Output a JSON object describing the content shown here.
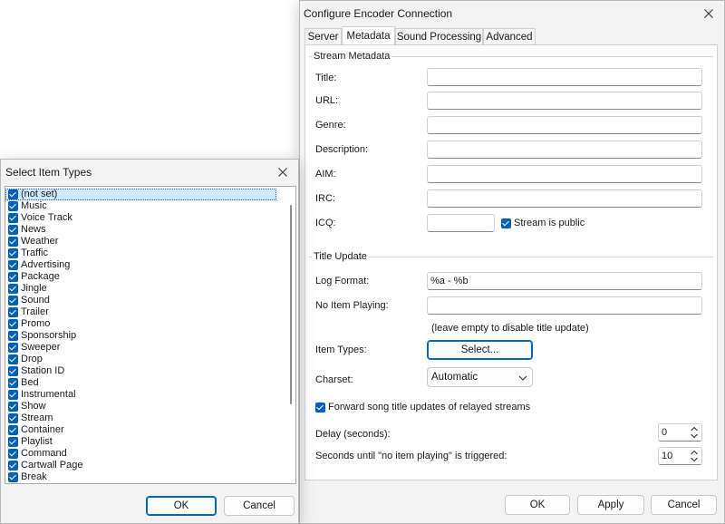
{
  "encoder_dialog": {
    "title": "Configure Encoder Connection",
    "tabs": [
      "Server",
      "Metadata",
      "Sound Processing",
      "Advanced"
    ],
    "active_tab": "Metadata",
    "stream_metadata": {
      "group_label": "Stream Metadata",
      "title_label": "Title:",
      "title_value": "",
      "url_label": "URL:",
      "url_value": "",
      "genre_label": "Genre:",
      "genre_value": "",
      "description_label": "Description:",
      "description_value": "",
      "aim_label": "AIM:",
      "aim_value": "",
      "irc_label": "IRC:",
      "irc_value": "",
      "icq_label": "ICQ:",
      "icq_value": "",
      "stream_public_label": "Stream is public",
      "stream_public_checked": true
    },
    "title_update": {
      "group_label": "Title Update",
      "log_format_label": "Log Format:",
      "log_format_value": "%a - %b",
      "no_item_label": "No Item Playing:",
      "no_item_value": "",
      "hint": "(leave empty to disable title update)",
      "item_types_label": "Item Types:",
      "select_button": "Select...",
      "charset_label": "Charset:",
      "charset_value": "Automatic",
      "forward_label": "Forward song title updates of relayed streams",
      "forward_checked": true,
      "delay_label": "Delay (seconds):",
      "delay_value": "0",
      "no_item_trigger_label": "Seconds until \"no item playing\" is triggered:",
      "no_item_trigger_value": "10"
    },
    "buttons": {
      "ok": "OK",
      "apply": "Apply",
      "cancel": "Cancel"
    }
  },
  "item_types_dialog": {
    "title": "Select Item Types",
    "items": [
      {
        "label": "(not set)",
        "checked": true
      },
      {
        "label": "Music",
        "checked": true
      },
      {
        "label": "Voice Track",
        "checked": true
      },
      {
        "label": "News",
        "checked": true
      },
      {
        "label": "Weather",
        "checked": true
      },
      {
        "label": "Traffic",
        "checked": true
      },
      {
        "label": "Advertising",
        "checked": true
      },
      {
        "label": "Package",
        "checked": true
      },
      {
        "label": "Jingle",
        "checked": true
      },
      {
        "label": "Sound",
        "checked": true
      },
      {
        "label": "Trailer",
        "checked": true
      },
      {
        "label": "Promo",
        "checked": true
      },
      {
        "label": "Sponsorship",
        "checked": true
      },
      {
        "label": "Sweeper",
        "checked": true
      },
      {
        "label": "Drop",
        "checked": true
      },
      {
        "label": "Station ID",
        "checked": true
      },
      {
        "label": "Bed",
        "checked": true
      },
      {
        "label": "Instrumental",
        "checked": true
      },
      {
        "label": "Show",
        "checked": true
      },
      {
        "label": "Stream",
        "checked": true
      },
      {
        "label": "Container",
        "checked": true
      },
      {
        "label": "Playlist",
        "checked": true
      },
      {
        "label": "Command",
        "checked": true
      },
      {
        "label": "Cartwall Page",
        "checked": true
      },
      {
        "label": "Break",
        "checked": true
      }
    ],
    "buttons": {
      "ok": "OK",
      "cancel": "Cancel"
    }
  },
  "icons": {
    "close": "close-icon",
    "chevron_down": "chevron-down-icon",
    "spin_up": "chevron-up-icon",
    "spin_down": "chevron-down-icon",
    "check": "checkmark-icon"
  },
  "colors": {
    "accent": "#005fb8",
    "primary_border": "#0067c0",
    "dialog_bg": "#f3f3f3",
    "panel_bg": "#ffffff"
  }
}
